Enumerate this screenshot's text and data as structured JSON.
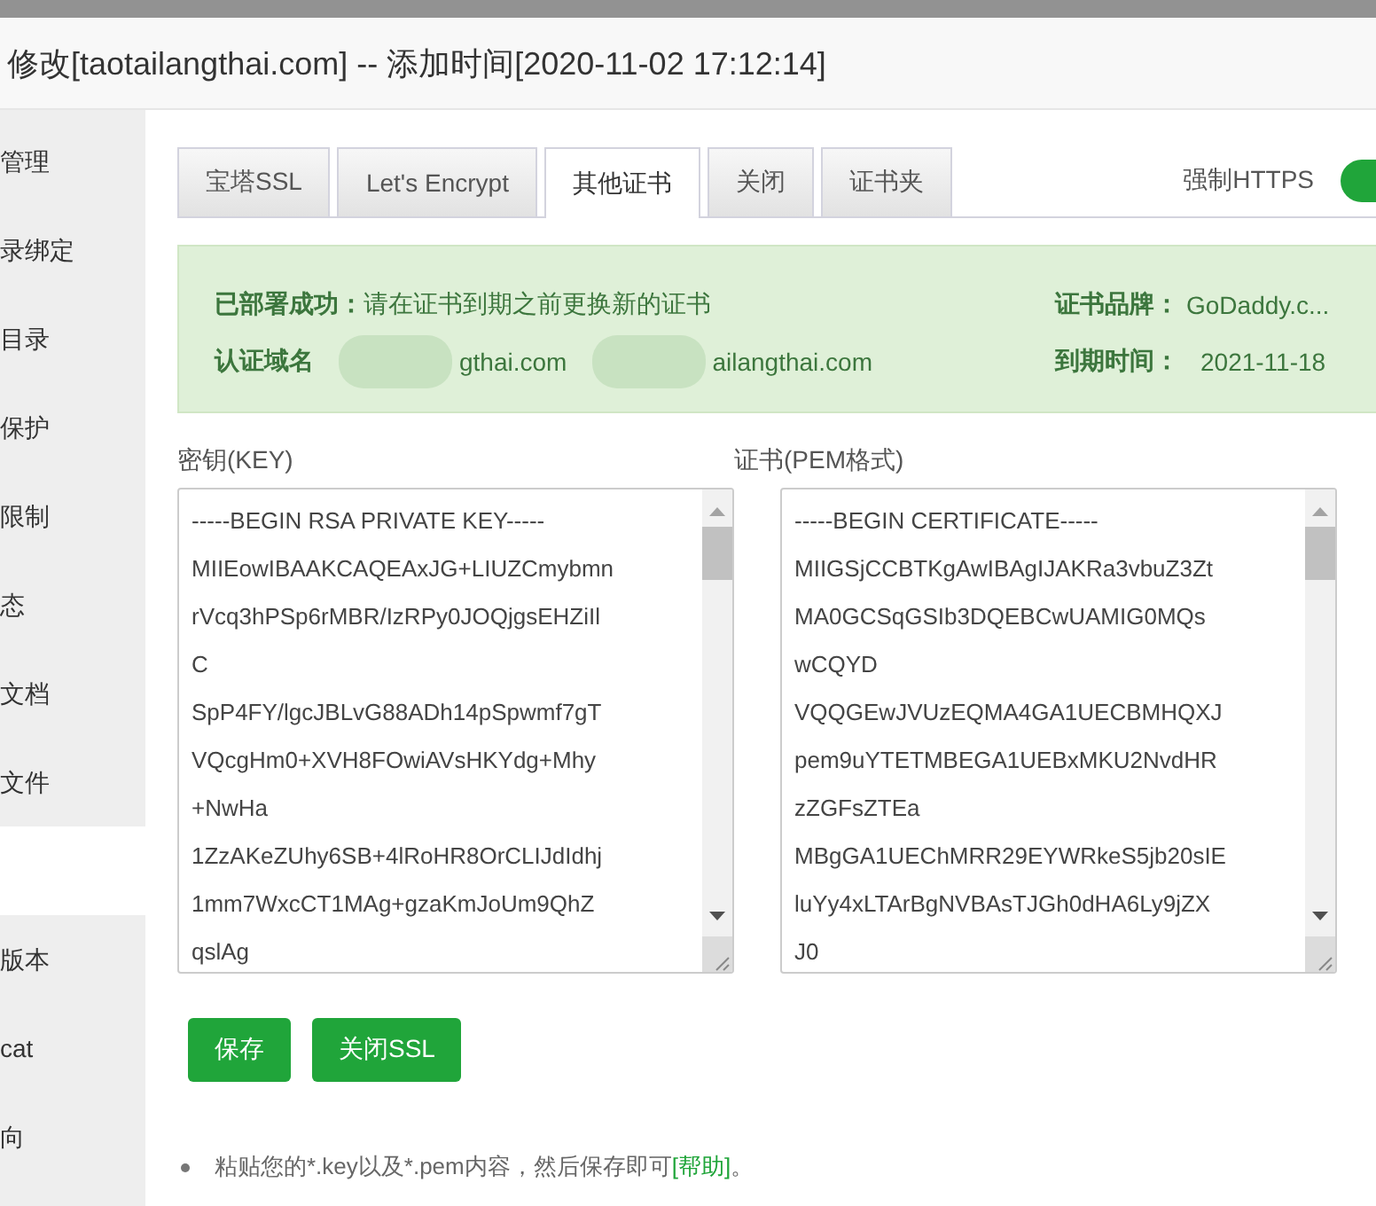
{
  "window": {
    "title": "修改[taotailangthai.com] -- 添加时间[2020-11-02 17:12:14]"
  },
  "sidebar": {
    "items": [
      {
        "label": "管理",
        "selected": false
      },
      {
        "label": "录绑定",
        "selected": false
      },
      {
        "label": "目录",
        "selected": false
      },
      {
        "label": "保护",
        "selected": false
      },
      {
        "label": "限制",
        "selected": false
      },
      {
        "label": "态",
        "selected": false
      },
      {
        "label": "文档",
        "selected": false
      },
      {
        "label": "文件",
        "selected": false
      },
      {
        "selected": true
      },
      {
        "label": "版本",
        "selected": false
      },
      {
        "label": "cat",
        "selected": false
      },
      {
        "label": "向",
        "selected": false
      }
    ]
  },
  "tabs": [
    {
      "label": "宝塔SSL",
      "selected": false
    },
    {
      "label": "Let's Encrypt",
      "selected": false
    },
    {
      "label": "其他证书",
      "selected": true
    },
    {
      "label": "关闭",
      "selected": false
    },
    {
      "label": "证书夹",
      "selected": false
    }
  ],
  "force_https": {
    "label": "强制HTTPS",
    "on": true
  },
  "status": {
    "message": "**已部署成功：**请在证书到期之前更换新的证书",
    "domain_label": "认证域名",
    "domains": [
      "gthai.com",
      "ailangthai.com"
    ],
    "brand_label": "证书品牌：",
    "brand": "GoDaddy.c...",
    "expiry_label": "到期时间：",
    "expiry": "2021-11-18"
  },
  "key_field": {
    "label": "密钥(KEY)",
    "value": "-----BEGIN RSA PRIVATE KEY-----\nMIIEowIBAAKCAQEAxJG+LIUZCmybmn\nrVcq3hPSp6rMBR/IzRPy0JOQjgsEHZiIl\nC\nSpP4FY/lgcJBLvG88ADh14pSpwmf7gT\nVQcgHm0+XVH8FOwiAVsHKYdg+Mhy\n+NwHa\n1ZzAKeZUhy6SB+4lRoHR8OrCLIJdIdhj\n1mm7WxcCT1MAg+gzaKmJoUm9QhZ\nqslAg"
  },
  "cert_field": {
    "label": "证书(PEM格式)",
    "value": "-----BEGIN CERTIFICATE-----\nMIIGSjCCBTKgAwIBAgIJAKRa3vbuZ3Zt\nMA0GCSqGSIb3DQEBCwUAMIG0MQs\nwCQYD\nVQQGEwJVUzEQMA4GA1UECBMHQXJ\npem9uYTETMBEGA1UEBxMKU2NvdHR\nzZGFsZTEa\nMBgGA1UEChMRR29EYWRkeS5jb20sIE\nluYy4xLTArBgNVBAsTJGh0dHA6Ly9jZX\nJ0"
  },
  "buttons": [
    {
      "label": "保存"
    },
    {
      "label": "关闭SSL"
    }
  ],
  "note": {
    "text": "粘贴您的*.key以及*.pem内容，然后保存即可",
    "link": "[帮助]",
    "end": "。"
  }
}
